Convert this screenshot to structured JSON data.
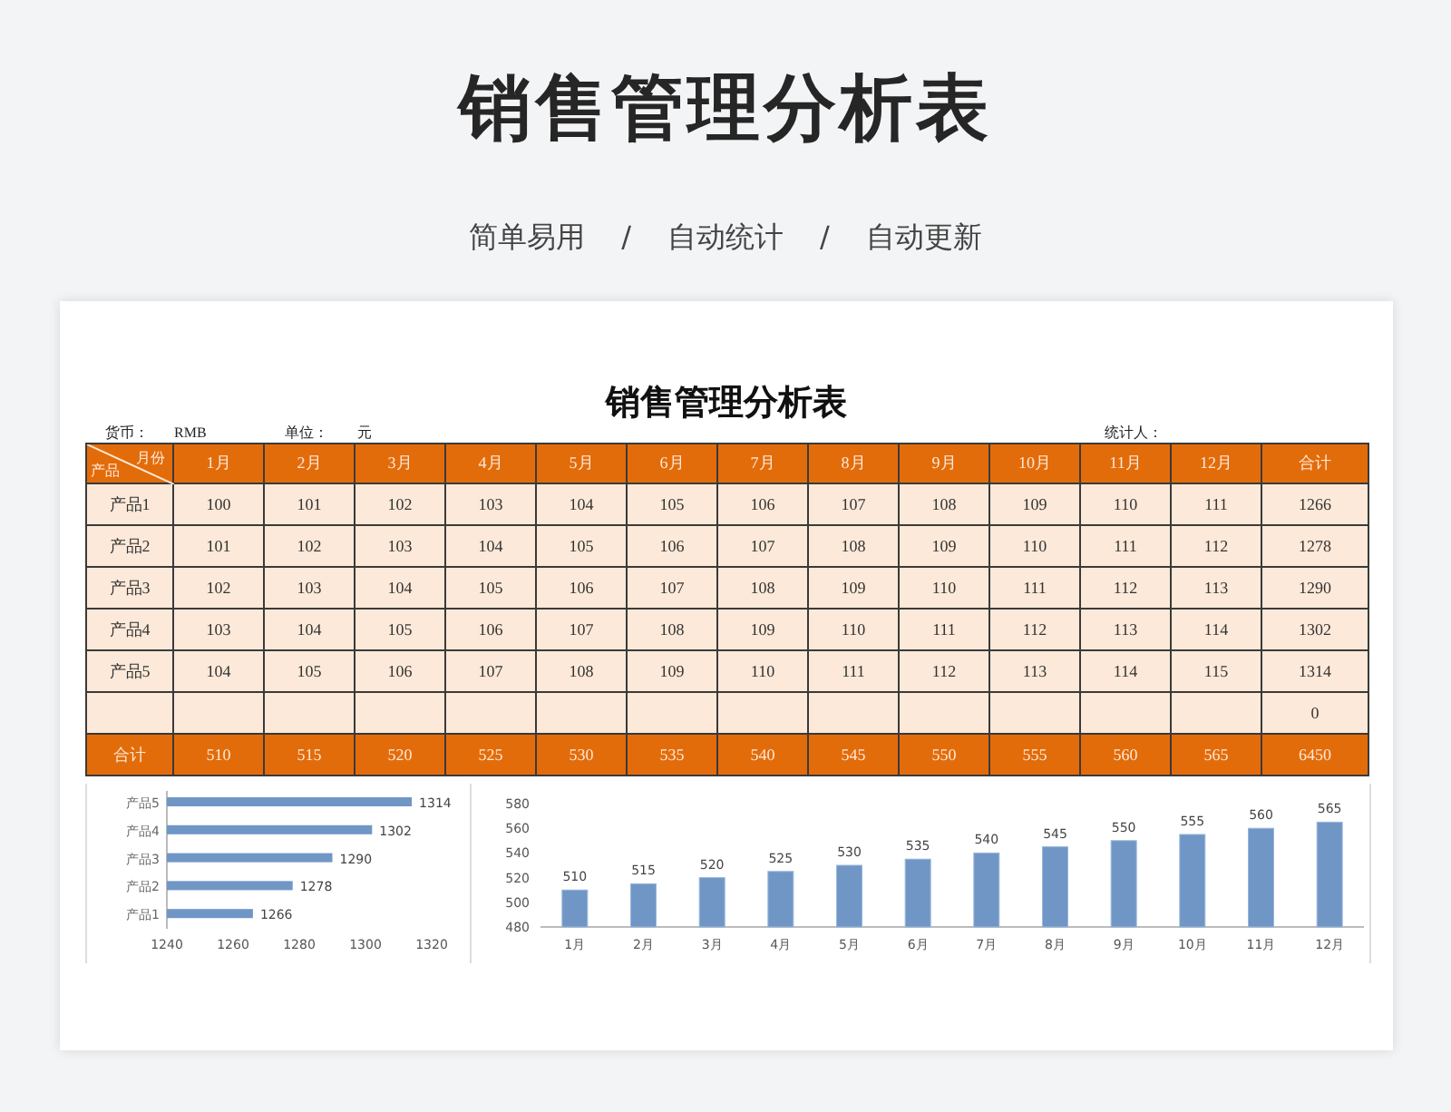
{
  "banner": {
    "title": "销售管理分析表",
    "subtitle": [
      "简单易用",
      "/",
      "自动统计",
      "/",
      "自动更新"
    ]
  },
  "sheet": {
    "title": "销售管理分析表",
    "info": {
      "currency_label": "货币：",
      "currency": "RMB",
      "unit_label": "单位：",
      "unit": "元",
      "stat_label": "统计人："
    },
    "corner": {
      "top": "月份",
      "bottom": "产品"
    },
    "columns": [
      "1月",
      "2月",
      "3月",
      "4月",
      "5月",
      "6月",
      "7月",
      "8月",
      "9月",
      "10月",
      "11月",
      "12月",
      "合计"
    ],
    "rows": [
      {
        "kind": "data",
        "label": "产品1",
        "values": [
          "100",
          "101",
          "102",
          "103",
          "104",
          "105",
          "106",
          "107",
          "108",
          "109",
          "110",
          "111"
        ],
        "total": "1266"
      },
      {
        "kind": "data",
        "label": "产品2",
        "values": [
          "101",
          "102",
          "103",
          "104",
          "105",
          "106",
          "107",
          "108",
          "109",
          "110",
          "111",
          "112"
        ],
        "total": "1278"
      },
      {
        "kind": "data",
        "label": "产品3",
        "values": [
          "102",
          "103",
          "104",
          "105",
          "106",
          "107",
          "108",
          "109",
          "110",
          "111",
          "112",
          "113"
        ],
        "total": "1290"
      },
      {
        "kind": "data",
        "label": "产品4",
        "values": [
          "103",
          "104",
          "105",
          "106",
          "107",
          "108",
          "109",
          "110",
          "111",
          "112",
          "113",
          "114"
        ],
        "total": "1302"
      },
      {
        "kind": "data",
        "label": "产品5",
        "values": [
          "104",
          "105",
          "106",
          "107",
          "108",
          "109",
          "110",
          "111",
          "112",
          "113",
          "114",
          "115"
        ],
        "total": "1314"
      },
      {
        "kind": "blank",
        "total": "0"
      },
      {
        "kind": "total",
        "label": "合计",
        "values": [
          "510",
          "515",
          "520",
          "525",
          "530",
          "535",
          "540",
          "545",
          "550",
          "555",
          "560",
          "565"
        ],
        "total": "6450"
      }
    ],
    "charts": [
      {
        "chart_data": {
          "type": "bar",
          "orientation": "horizontal",
          "categories": [
            "产品5",
            "产品4",
            "产品3",
            "产品2",
            "产品1"
          ],
          "series": [
            {
              "color": "#7096c6",
              "values": [
                1314,
                1302,
                1290,
                1278,
                1266
              ]
            }
          ],
          "xlim": [
            1240,
            1320
          ],
          "xticks": [
            1240,
            1260,
            1280,
            1300,
            1320
          ],
          "data_labels": true
        }
      },
      {
        "chart_data": {
          "type": "bar",
          "orientation": "vertical",
          "categories": [
            "1月",
            "2月",
            "3月",
            "4月",
            "5月",
            "6月",
            "7月",
            "8月",
            "9月",
            "10月",
            "11月",
            "12月"
          ],
          "series": [
            {
              "color": "#7096c6",
              "values": [
                510,
                515,
                520,
                525,
                530,
                535,
                540,
                545,
                550,
                555,
                560,
                565
              ]
            }
          ],
          "ylim": [
            480,
            580
          ],
          "yticks": [
            480,
            500,
            520,
            540,
            560,
            580
          ],
          "data_labels": true
        }
      }
    ]
  }
}
